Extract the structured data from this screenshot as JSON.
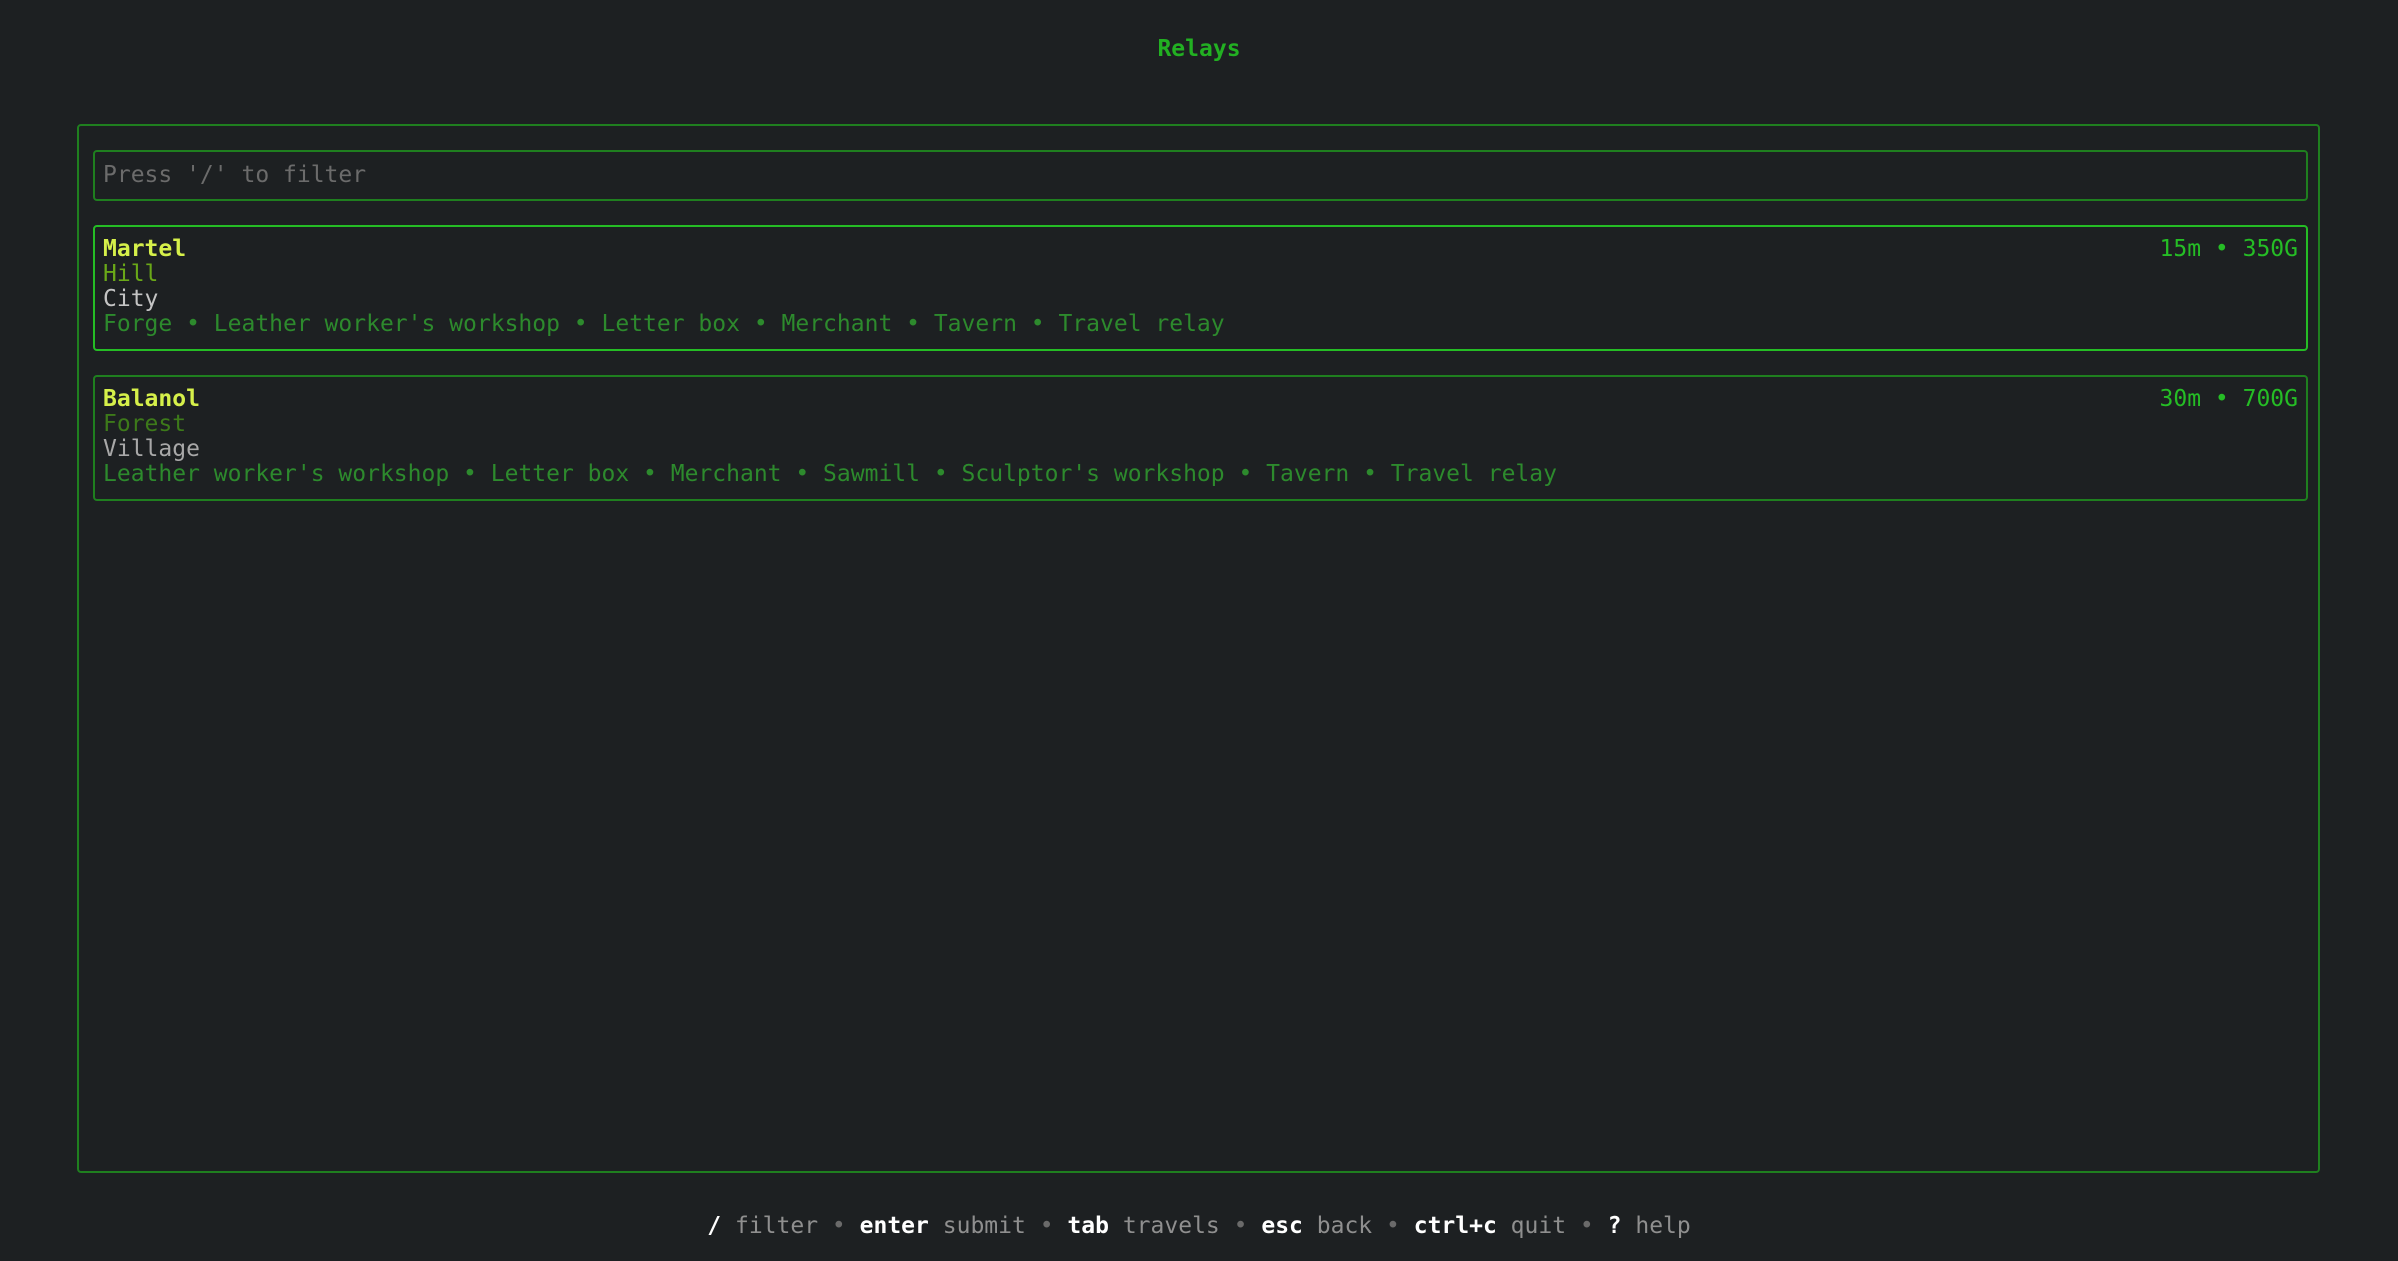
{
  "header": {
    "title": "Relays"
  },
  "filter": {
    "placeholder": "Press '/' to filter"
  },
  "relays": [
    {
      "name": "Martel",
      "terrain": "Hill",
      "kind": "City",
      "facilities": "Forge • Leather worker's workshop • Letter box • Merchant • Tavern • Travel relay",
      "meta": "15m • 350G"
    },
    {
      "name": "Balanol",
      "terrain": "Forest",
      "kind": "Village",
      "facilities": "Leather worker's workshop • Letter box • Merchant • Sawmill • Sculptor's workshop • Tavern • Travel relay",
      "meta": "30m • 700G"
    }
  ],
  "footer": {
    "separator": "•",
    "items": [
      {
        "key": "/",
        "desc": "filter"
      },
      {
        "key": "enter",
        "desc": "submit"
      },
      {
        "key": "tab",
        "desc": "travels"
      },
      {
        "key": "esc",
        "desc": "back"
      },
      {
        "key": "ctrl+c",
        "desc": "quit"
      },
      {
        "key": "?",
        "desc": "help"
      }
    ]
  },
  "colors": {
    "background": "#1d2022",
    "accent": "#22b022",
    "border": "#1f7f1f",
    "name": "#d6f04a"
  }
}
